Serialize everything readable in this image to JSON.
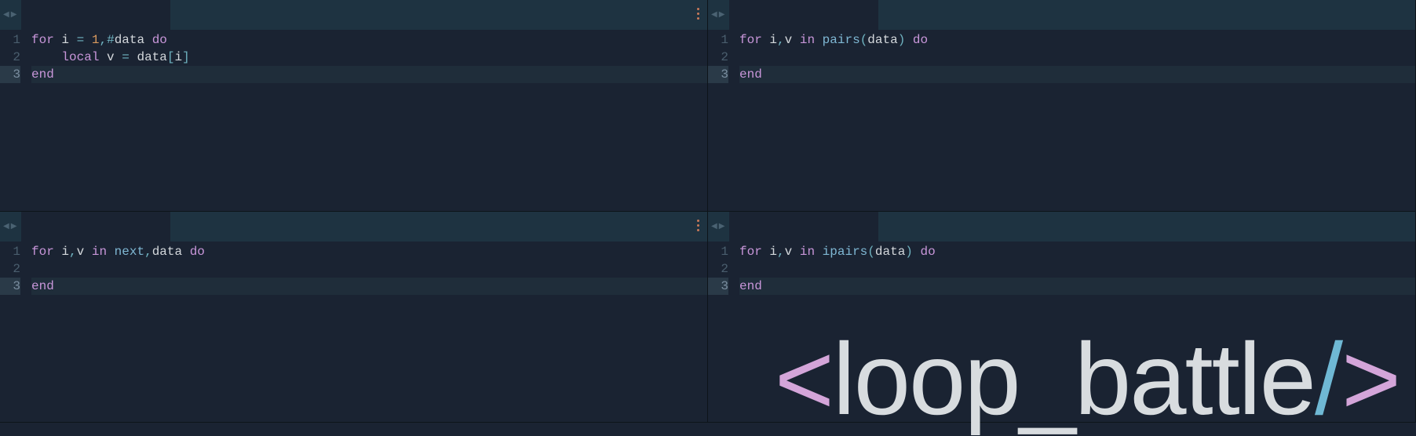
{
  "panes": [
    {
      "id": "top-left",
      "highlight_line": 3,
      "lines": [
        {
          "n": 1,
          "tokens": [
            {
              "t": "for",
              "c": "kw"
            },
            {
              "t": " "
            },
            {
              "t": "i",
              "c": "ident"
            },
            {
              "t": " "
            },
            {
              "t": "=",
              "c": "op"
            },
            {
              "t": " "
            },
            {
              "t": "1",
              "c": "num"
            },
            {
              "t": ",",
              "c": "op"
            },
            {
              "t": "#",
              "c": "op"
            },
            {
              "t": "data",
              "c": "ident"
            },
            {
              "t": " "
            },
            {
              "t": "do",
              "c": "kw"
            }
          ]
        },
        {
          "n": 2,
          "tokens": [
            {
              "t": "    "
            },
            {
              "t": "local",
              "c": "kw"
            },
            {
              "t": " "
            },
            {
              "t": "v",
              "c": "ident"
            },
            {
              "t": " "
            },
            {
              "t": "=",
              "c": "op"
            },
            {
              "t": " "
            },
            {
              "t": "data",
              "c": "ident"
            },
            {
              "t": "[",
              "c": "op"
            },
            {
              "t": "i",
              "c": "ident"
            },
            {
              "t": "]",
              "c": "op"
            }
          ]
        },
        {
          "n": 3,
          "tokens": [
            {
              "t": "end",
              "c": "kw"
            }
          ]
        }
      ]
    },
    {
      "id": "top-right",
      "highlight_line": 3,
      "lines": [
        {
          "n": 1,
          "tokens": [
            {
              "t": "for",
              "c": "kw"
            },
            {
              "t": " "
            },
            {
              "t": "i",
              "c": "ident"
            },
            {
              "t": ",",
              "c": "op"
            },
            {
              "t": "v",
              "c": "ident"
            },
            {
              "t": " "
            },
            {
              "t": "in",
              "c": "kw"
            },
            {
              "t": " "
            },
            {
              "t": "pairs",
              "c": "fn"
            },
            {
              "t": "(",
              "c": "op"
            },
            {
              "t": "data",
              "c": "ident"
            },
            {
              "t": ")",
              "c": "op"
            },
            {
              "t": " "
            },
            {
              "t": "do",
              "c": "kw"
            }
          ]
        },
        {
          "n": 2,
          "tokens": []
        },
        {
          "n": 3,
          "tokens": [
            {
              "t": "end",
              "c": "kw"
            }
          ]
        }
      ]
    },
    {
      "id": "bottom-left",
      "highlight_line": 3,
      "lines": [
        {
          "n": 1,
          "tokens": [
            {
              "t": "for",
              "c": "kw"
            },
            {
              "t": " "
            },
            {
              "t": "i",
              "c": "ident"
            },
            {
              "t": ",",
              "c": "op"
            },
            {
              "t": "v",
              "c": "ident"
            },
            {
              "t": " "
            },
            {
              "t": "in",
              "c": "kw"
            },
            {
              "t": " "
            },
            {
              "t": "next",
              "c": "fn"
            },
            {
              "t": ",",
              "c": "op"
            },
            {
              "t": "data",
              "c": "ident"
            },
            {
              "t": " "
            },
            {
              "t": "do",
              "c": "kw"
            }
          ]
        },
        {
          "n": 2,
          "tokens": []
        },
        {
          "n": 3,
          "tokens": [
            {
              "t": "end",
              "c": "kw"
            }
          ]
        }
      ]
    },
    {
      "id": "bottom-right",
      "highlight_line": 3,
      "lines": [
        {
          "n": 1,
          "tokens": [
            {
              "t": "for",
              "c": "kw"
            },
            {
              "t": " "
            },
            {
              "t": "i",
              "c": "ident"
            },
            {
              "t": ",",
              "c": "op"
            },
            {
              "t": "v",
              "c": "ident"
            },
            {
              "t": " "
            },
            {
              "t": "in",
              "c": "kw"
            },
            {
              "t": " "
            },
            {
              "t": "ipairs",
              "c": "fn"
            },
            {
              "t": "(",
              "c": "op"
            },
            {
              "t": "data",
              "c": "ident"
            },
            {
              "t": ")",
              "c": "op"
            },
            {
              "t": " "
            },
            {
              "t": "do",
              "c": "kw"
            }
          ]
        },
        {
          "n": 2,
          "tokens": []
        },
        {
          "n": 3,
          "tokens": [
            {
              "t": "end",
              "c": "kw"
            }
          ]
        }
      ]
    }
  ],
  "overlay": {
    "open": "<",
    "text": "loop_battle",
    "slash": "/",
    "close": ">"
  }
}
